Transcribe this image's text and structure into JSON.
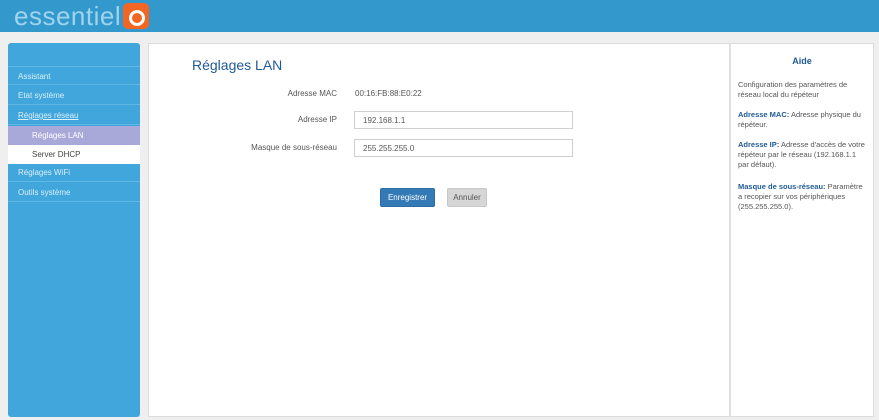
{
  "brand": {
    "name": "essentiel"
  },
  "sidebar": {
    "items": [
      {
        "label": "Assistant"
      },
      {
        "label": "Etat système"
      },
      {
        "label": "Réglages réseau"
      },
      {
        "label": "Réglages LAN"
      },
      {
        "label": "Server DHCP"
      },
      {
        "label": "Réglages WiFi"
      },
      {
        "label": "Outils système"
      }
    ]
  },
  "main": {
    "title": "Réglages LAN",
    "mac": {
      "label": "Adresse MAC",
      "value": "00:16:FB:88:E0:22"
    },
    "ip": {
      "label": "Adresse IP",
      "value": "192.168.1.1"
    },
    "mask": {
      "label": "Masque de sous-réseau",
      "value": "255.255.255.0"
    },
    "save_label": "Enregistrer",
    "cancel_label": "Annuler"
  },
  "help": {
    "title": "Aide",
    "intro": "Configuration des paramètres de réseau local du répéteur",
    "mac_term": "Adresse MAC:",
    "mac_desc": "Adresse physique du répéteur.",
    "ip_term": "Adresse IP:",
    "ip_desc": "Adresse d'accès de votre répéteur par le réseau (192.168.1.1 par défaut).",
    "mask_term": "Masque de sous-réseau:",
    "mask_desc": "Paramètre a recopier sur vos périphériques (255.255.255.0)."
  },
  "colors": {
    "header": "#3399cc",
    "sidebar": "#41a6dc",
    "accent": "#337ab7",
    "logo": "#f26522"
  }
}
